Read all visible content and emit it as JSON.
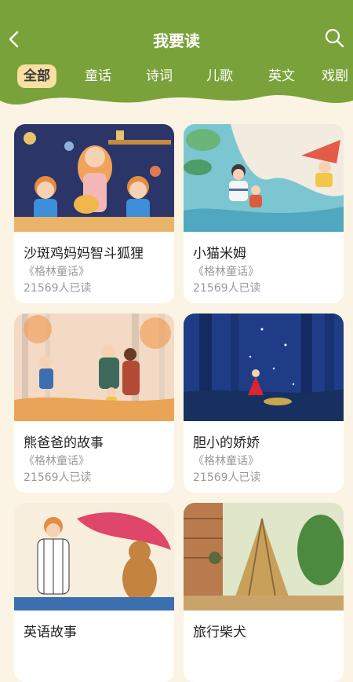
{
  "header": {
    "title": "我要读",
    "colors": {
      "bar": "#7aa23a",
      "tab_active_bg": "#f8e0a2",
      "page_bg": "#fbf3e3"
    }
  },
  "tabs": [
    {
      "label": "全部",
      "active": true
    },
    {
      "label": "童话",
      "active": false
    },
    {
      "label": "诗词",
      "active": false
    },
    {
      "label": "儿歌",
      "active": false
    },
    {
      "label": "英文",
      "active": false
    },
    {
      "label": "戏剧",
      "active": false
    }
  ],
  "books": [
    {
      "title": "沙斑鸡妈妈智斗狐狸",
      "series": "《格林童话》",
      "reads": "21569人已读"
    },
    {
      "title": "小猫米姆",
      "series": "《格林童话》",
      "reads": "21569人已读"
    },
    {
      "title": "熊爸爸的故事",
      "series": "《格林童话》",
      "reads": "21569人已读"
    },
    {
      "title": "胆小的娇娇",
      "series": "《格林童话》",
      "reads": "21569人已读"
    },
    {
      "title": "英语故事",
      "series": "",
      "reads": ""
    },
    {
      "title": "旅行柴犬",
      "series": "",
      "reads": ""
    }
  ]
}
